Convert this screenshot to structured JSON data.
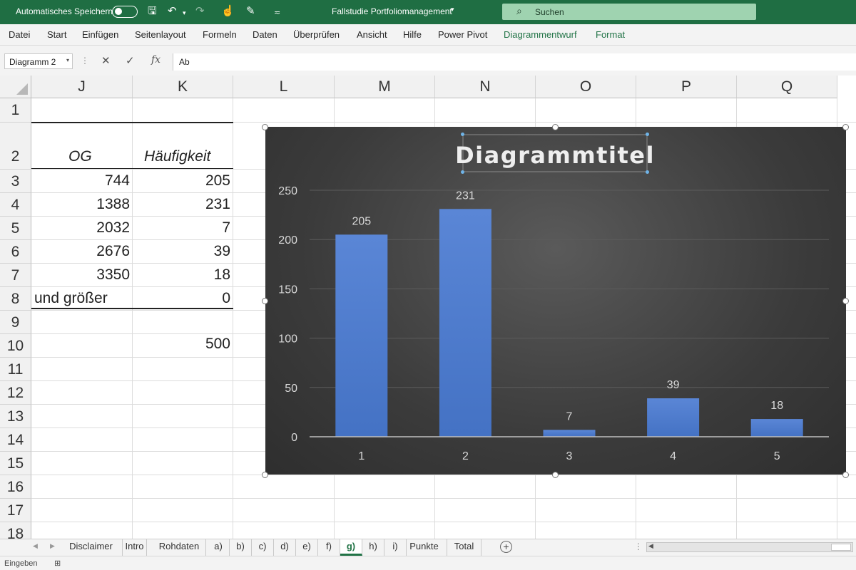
{
  "titlebar": {
    "autosave_label": "Automatisches Speichern",
    "document_title": "Fallstudie Portfoliomanagement",
    "search_label": "Suchen"
  },
  "menu": [
    "Datei",
    "Start",
    "Einfügen",
    "Seitenlayout",
    "Formeln",
    "Daten",
    "Überprüfen",
    "Ansicht",
    "Hilfe",
    "Power Pivot",
    "Diagrammentwurf",
    "Format"
  ],
  "formula_bar": {
    "name_box": "Diagramm 2",
    "fx_label": "fx",
    "content": "Ab"
  },
  "columns": [
    "J",
    "K",
    "L",
    "M",
    "N",
    "O",
    "P",
    "Q"
  ],
  "rows": [
    "1",
    "2",
    "3",
    "4",
    "5",
    "6",
    "7",
    "8",
    "9",
    "10",
    "11",
    "12",
    "13",
    "14",
    "15",
    "16",
    "17",
    "18"
  ],
  "table": {
    "header_og": "OG",
    "header_freq": "Häufigkeit",
    "rows": [
      {
        "og": "744",
        "freq": "205"
      },
      {
        "og": "1388",
        "freq": "231"
      },
      {
        "og": "2032",
        "freq": "7"
      },
      {
        "og": "2676",
        "freq": "39"
      },
      {
        "og": "3350",
        "freq": "18"
      },
      {
        "og": "und größer",
        "freq": "0"
      }
    ],
    "total": "500"
  },
  "colors": {
    "excel_green": "#1f6e43",
    "bar_blue": "#4472c4",
    "chart_bg": "#404040"
  },
  "chart_data": {
    "type": "bar",
    "title": "Diagrammtitel",
    "categories": [
      "1",
      "2",
      "3",
      "4",
      "5"
    ],
    "values": [
      205,
      231,
      7,
      39,
      18
    ],
    "ylim": [
      0,
      250
    ],
    "yticks": [
      0,
      50,
      100,
      150,
      200,
      250
    ],
    "data_labels": true,
    "grid": true,
    "legend": "none"
  },
  "sheet_tabs": [
    "Disclaimer",
    "Intro",
    "Rohdaten",
    "a)",
    "b)",
    "c)",
    "d)",
    "e)",
    "f)",
    "g)",
    "h)",
    "i)",
    "Punkte",
    "Total"
  ],
  "active_tab": "g)",
  "status": {
    "mode": "Eingeben"
  }
}
